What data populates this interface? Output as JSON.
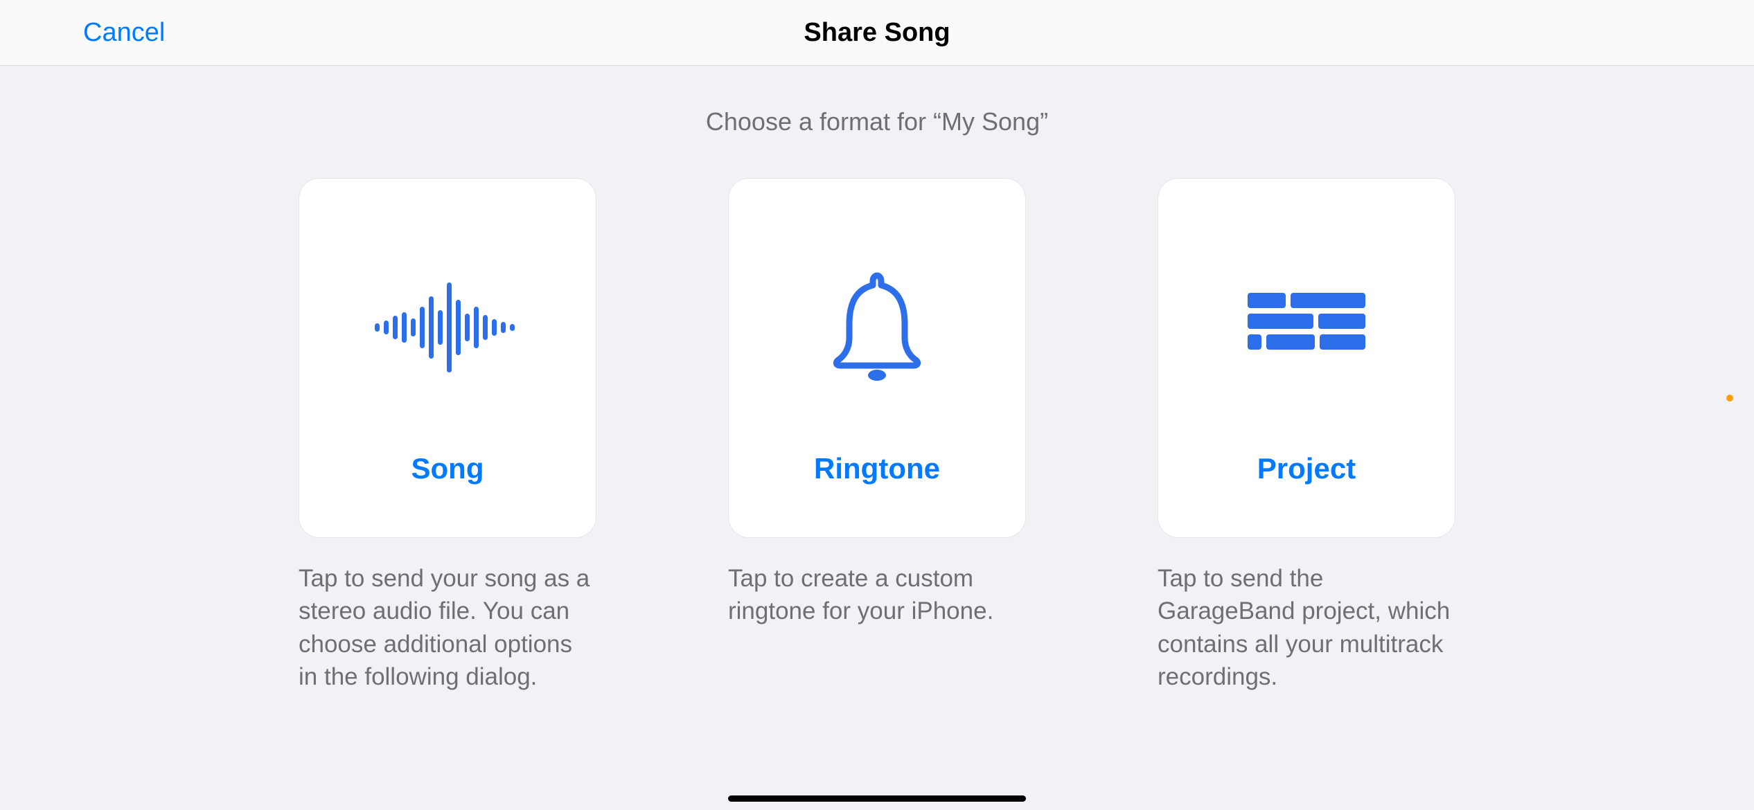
{
  "header": {
    "cancel_label": "Cancel",
    "title": "Share Song"
  },
  "subtitle": "Choose a format for “My Song”",
  "options": [
    {
      "title": "Song",
      "description": "Tap to send your song as a stereo audio file. You can choose additional options in the following dialog."
    },
    {
      "title": "Ringtone",
      "description": "Tap to create a custom ringtone for your iPhone."
    },
    {
      "title": "Project",
      "description": "Tap to send the GarageBand project, which contains all your multitrack recordings."
    }
  ],
  "colors": {
    "accent": "#007aff",
    "background": "#f2f2f6",
    "card_background": "#ffffff",
    "text_secondary": "#6e6e73",
    "indicator_dot": "#ff9f0a"
  }
}
